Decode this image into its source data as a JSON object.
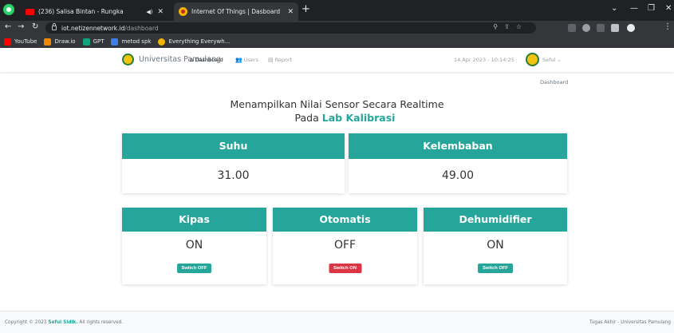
{
  "browser": {
    "tabs": [
      {
        "title": "(236) Salisa Bintan - Rungka",
        "active": false
      },
      {
        "title": "Internet Of Things | Dasboard",
        "active": true
      }
    ],
    "url": {
      "host": "iot.netizennetwork.id",
      "path": "/dashboard"
    },
    "bookmarks": [
      {
        "label": "YouTube",
        "color": "#ff0000"
      },
      {
        "label": "Draw.io",
        "color": "#f08705"
      },
      {
        "label": "GPT",
        "color": "#10a37f"
      },
      {
        "label": "metod spk",
        "color": "#3f7ee8"
      },
      {
        "label": "Everything Everywh...",
        "color": "#f4b400"
      }
    ]
  },
  "navbar": {
    "brand": "Universitas Pamulang",
    "items": [
      {
        "label": "Dashboard",
        "icon": "home-icon",
        "active": true
      },
      {
        "label": "Users",
        "icon": "users-icon",
        "active": false
      },
      {
        "label": "Report",
        "icon": "report-icon",
        "active": false
      }
    ],
    "datetime": "14 Apr 2023 - 10:14:25",
    "user": "Seful"
  },
  "breadcrumb": "Dashboard",
  "heading": {
    "line1": "Menampilkan Nilai Sensor Secara Realtime",
    "line2_prefix": "Pada",
    "lab": "Lab Kalibrasi"
  },
  "sensors": [
    {
      "label": "Suhu",
      "value": "31.00"
    },
    {
      "label": "Kelembaban",
      "value": "49.00"
    }
  ],
  "devices": [
    {
      "label": "Kipas",
      "state": "ON",
      "button": "Switch OFF"
    },
    {
      "label": "Otomatis",
      "state": "OFF",
      "button": "Switch ON"
    },
    {
      "label": "Dehumidifier",
      "state": "ON",
      "button": "Switch OFF"
    }
  ],
  "footer": {
    "copyright_prefix": "Copyright © 2023",
    "author": "Seful Sidik.",
    "suffix": "All rights reserved.",
    "right": "Tugas Akhir - Universitas Pamulang"
  },
  "colors": {
    "accent": "#26a69a",
    "danger": "#dc3545"
  }
}
